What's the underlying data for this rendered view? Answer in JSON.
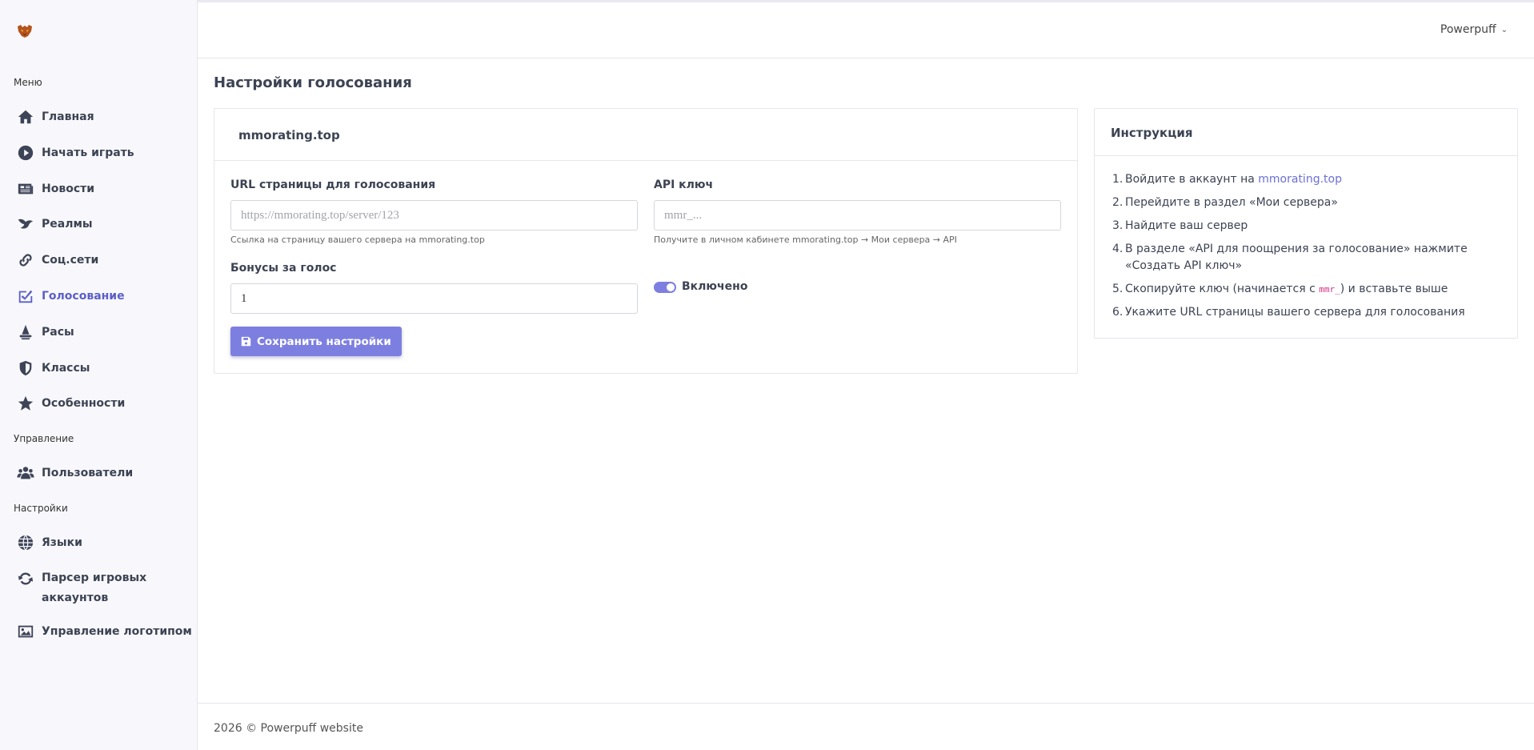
{
  "app": {
    "user_name": "Powerpuff"
  },
  "sidebar": {
    "sections": [
      {
        "label": "Меню"
      },
      {
        "label": "Управление"
      },
      {
        "label": "Настройки"
      }
    ],
    "items": [
      {
        "label": "Главная",
        "icon": "home-icon"
      },
      {
        "label": "Начать играть",
        "icon": "play-icon"
      },
      {
        "label": "Новости",
        "icon": "newspaper-icon"
      },
      {
        "label": "Реалмы",
        "icon": "dragon-icon"
      },
      {
        "label": "Соц.сети",
        "icon": "link-icon"
      },
      {
        "label": "Голосование",
        "icon": "vote-icon",
        "active": true
      },
      {
        "label": "Расы",
        "icon": "wizard-icon"
      },
      {
        "label": "Классы",
        "icon": "shield-icon"
      },
      {
        "label": "Особенности",
        "icon": "star-icon"
      },
      {
        "label": "Пользователи",
        "icon": "users-icon"
      },
      {
        "label": "Языки",
        "icon": "globe-icon"
      },
      {
        "label": "Парсер игровых аккаунтов",
        "icon": "sync-icon"
      },
      {
        "label": "Управление логотипом",
        "icon": "image-icon"
      }
    ]
  },
  "page": {
    "title": "Настройки голосования"
  },
  "form_card": {
    "header": "mmorating.top",
    "url_label": "URL страницы для голосования",
    "url_placeholder": "https://mmorating.top/server/123",
    "url_value": "",
    "url_help": "Ссылка на страницу вашего сервера на mmorating.top",
    "api_label": "API ключ",
    "api_placeholder": "mmr_...",
    "api_value": "",
    "api_help": "Получите в личном кабинете mmorating.top → Мои сервера → API",
    "bonus_label": "Бонусы за голос",
    "bonus_value": "1",
    "toggle_label": "Включено",
    "toggle_on": true,
    "save_label": "Сохранить настройки"
  },
  "instructions": {
    "header": "Инструкция",
    "steps": [
      {
        "num": "1.",
        "text": "Войдите в аккаунт на ",
        "link": "mmorating.top"
      },
      {
        "num": "2.",
        "text": "Перейдите в раздел «Мои сервера»"
      },
      {
        "num": "3.",
        "text": "Найдите ваш сервер"
      },
      {
        "num": "4.",
        "text": "В разделе «API для поощрения за голосование» нажмите «Создать API ключ»"
      },
      {
        "num": "5.",
        "text_before": "Скопируйте ключ (начинается с ",
        "code": "mmr_",
        "text_after": ") и вставьте выше"
      },
      {
        "num": "6.",
        "text": "Укажите URL страницы вашего сервера для голосования"
      }
    ]
  },
  "footer": {
    "text": "2026 © Powerpuff website"
  },
  "colors": {
    "accent": "#7d7fe0",
    "active_nav": "#5b5fc7",
    "sidebar_bg": "#f8f8fc"
  }
}
